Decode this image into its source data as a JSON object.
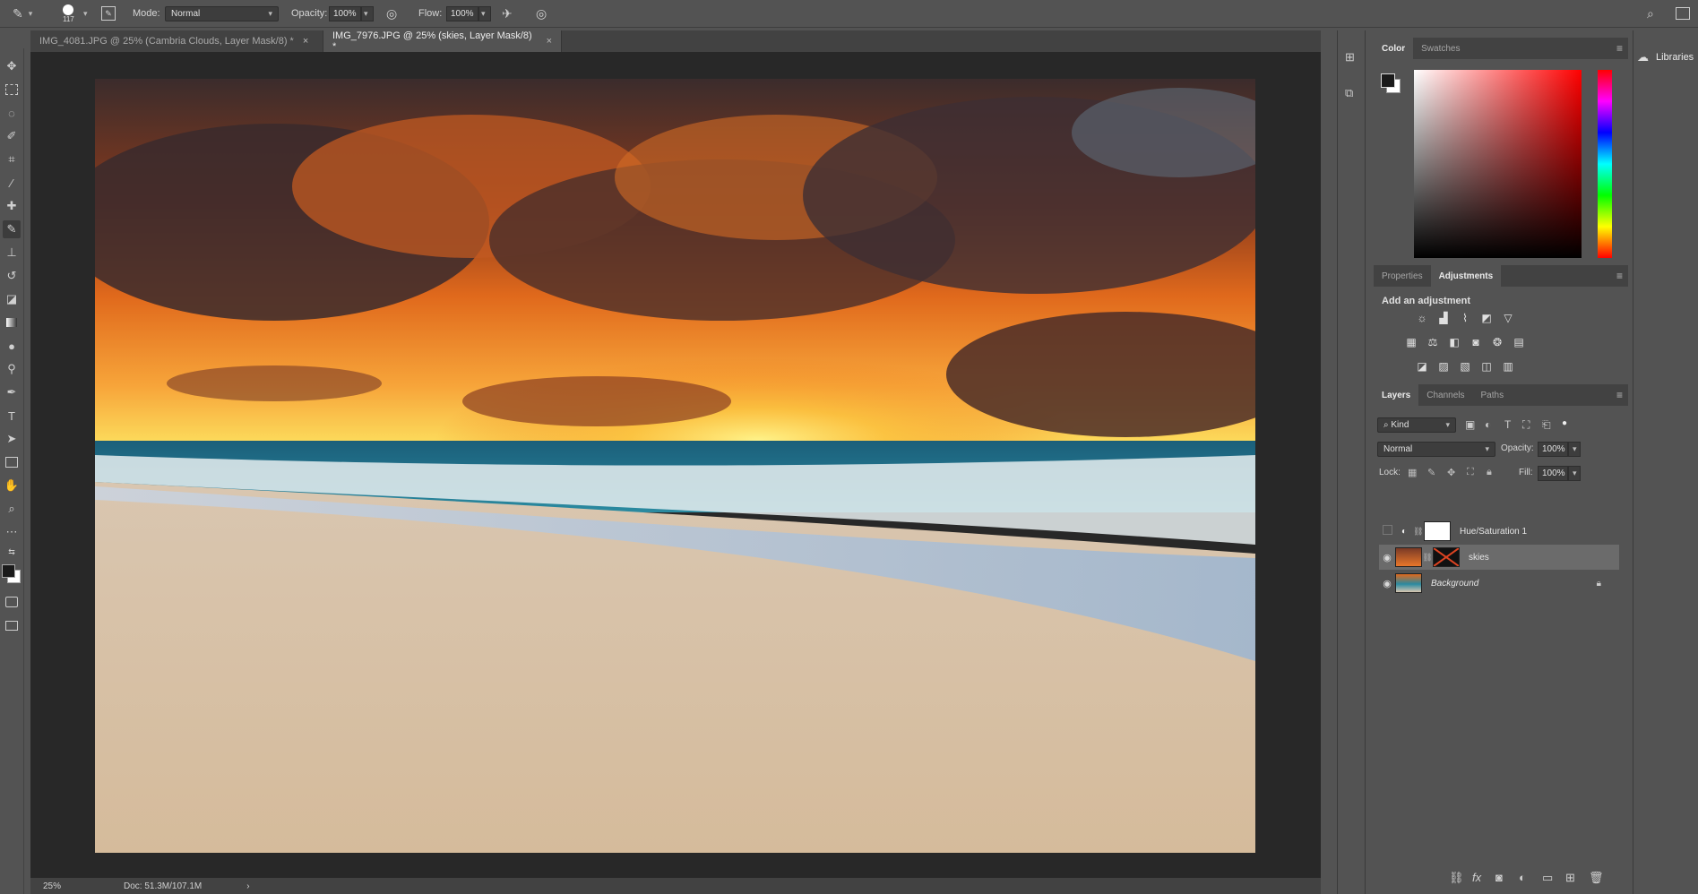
{
  "options_bar": {
    "brush_size": "117",
    "mode_label": "Mode:",
    "mode_value": "Normal",
    "opacity_label": "Opacity:",
    "opacity_value": "100%",
    "flow_label": "Flow:",
    "flow_value": "100%"
  },
  "document_tabs": [
    {
      "label": "IMG_4081.JPG @ 25% (Cambria Clouds, Layer Mask/8) *",
      "close": "×"
    },
    {
      "label": "IMG_7976.JPG @ 25% (skies, Layer Mask/8) *",
      "close": "×"
    }
  ],
  "status_bar": {
    "zoom": "25%",
    "doc_size": "Doc: 51.3M/107.1M",
    "arrow": "›"
  },
  "color_panel": {
    "tabs": [
      "Color",
      "Swatches"
    ],
    "foreground_color": "#1a1a1a",
    "background_color": "#ffffff",
    "hue_color": "#ff0000"
  },
  "adjustments_panel": {
    "tabs": [
      "Properties",
      "Adjustments"
    ],
    "heading": "Add an adjustment"
  },
  "layers_panel": {
    "tabs": [
      "Layers",
      "Channels",
      "Paths"
    ],
    "filter_kind": "Kind",
    "blend_mode": "Normal",
    "opacity_label": "Opacity:",
    "opacity_value": "100%",
    "lock_label": "Lock:",
    "fill_label": "Fill:",
    "fill_value": "100%",
    "layers": [
      {
        "name": "Hue/Saturation 1",
        "visible": false,
        "selected": false
      },
      {
        "name": "skies",
        "visible": true,
        "selected": true
      },
      {
        "name": "Background",
        "visible": true,
        "selected": false,
        "locked": true
      }
    ]
  },
  "libraries": {
    "label": "Libraries"
  }
}
